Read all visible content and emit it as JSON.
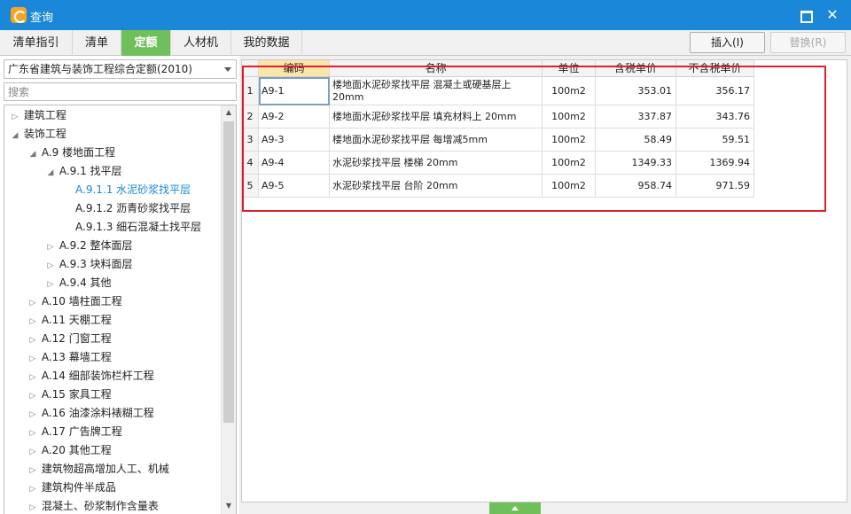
{
  "window": {
    "title": "查询",
    "maximize_icon": "maximize-icon",
    "close_symbol": "✕"
  },
  "tabs": [
    {
      "label": "清单指引",
      "active": false
    },
    {
      "label": "清单",
      "active": false
    },
    {
      "label": "定额",
      "active": true
    },
    {
      "label": "人材机",
      "active": false
    },
    {
      "label": "我的数据",
      "active": false
    }
  ],
  "toolbar": {
    "insert_label": "插入(I)",
    "replace_label": "替换(R)"
  },
  "left": {
    "quota_select": "广东省建筑与装饰工程综合定额(2010)",
    "search_placeholder": "搜索",
    "tree": [
      {
        "label": "建筑工程",
        "level": 0,
        "arrow": "▷"
      },
      {
        "label": "装饰工程",
        "level": 0,
        "arrow": "◢"
      },
      {
        "label": "A.9 楼地面工程",
        "level": 1,
        "arrow": "◢"
      },
      {
        "label": "A.9.1 找平层",
        "level": 2,
        "arrow": "◢"
      },
      {
        "label": "A.9.1.1 水泥砂浆找平层",
        "level": 3,
        "arrow": "",
        "selected": true
      },
      {
        "label": "A.9.1.2 沥青砂浆找平层",
        "level": 3,
        "arrow": ""
      },
      {
        "label": "A.9.1.3 细石混凝土找平层",
        "level": 3,
        "arrow": ""
      },
      {
        "label": "A.9.2 整体面层",
        "level": 2,
        "arrow": "▷"
      },
      {
        "label": "A.9.3 块料面层",
        "level": 2,
        "arrow": "▷"
      },
      {
        "label": "A.9.4 其他",
        "level": 2,
        "arrow": "▷"
      },
      {
        "label": "A.10 墙柱面工程",
        "level": 1,
        "arrow": "▷"
      },
      {
        "label": "A.11 天棚工程",
        "level": 1,
        "arrow": "▷"
      },
      {
        "label": "A.12 门窗工程",
        "level": 1,
        "arrow": "▷"
      },
      {
        "label": "A.13 幕墙工程",
        "level": 1,
        "arrow": "▷"
      },
      {
        "label": "A.14 细部装饰栏杆工程",
        "level": 1,
        "arrow": "▷"
      },
      {
        "label": "A.15 家具工程",
        "level": 1,
        "arrow": "▷"
      },
      {
        "label": "A.16 油漆涂料裱糊工程",
        "level": 1,
        "arrow": "▷"
      },
      {
        "label": "A.17 广告牌工程",
        "level": 1,
        "arrow": "▷"
      },
      {
        "label": "A.20 其他工程",
        "level": 1,
        "arrow": "▷"
      },
      {
        "label": "建筑物超高增加人工、机械",
        "level": 1,
        "arrow": "▷"
      },
      {
        "label": "建筑构件半成品",
        "level": 1,
        "arrow": "▷"
      },
      {
        "label": "混凝土、砂浆制作含量表",
        "level": 1,
        "arrow": "▷"
      }
    ]
  },
  "table": {
    "headers": [
      "编码",
      "名称",
      "单位",
      "含税单价",
      "不含税单价"
    ],
    "rows": [
      {
        "n": "1",
        "code": "A9-1",
        "name": "楼地面水泥砂浆找平层 混凝土或硬基层上 20mm",
        "unit": "100m2",
        "tax_price": "353.01",
        "notax_price": "356.17"
      },
      {
        "n": "2",
        "code": "A9-2",
        "name": "楼地面水泥砂浆找平层 填充材料上 20mm",
        "unit": "100m2",
        "tax_price": "337.87",
        "notax_price": "343.76"
      },
      {
        "n": "3",
        "code": "A9-3",
        "name": "楼地面水泥砂浆找平层 每增减5mm",
        "unit": "100m2",
        "tax_price": "58.49",
        "notax_price": "59.51"
      },
      {
        "n": "4",
        "code": "A9-4",
        "name": "水泥砂浆找平层 楼梯 20mm",
        "unit": "100m2",
        "tax_price": "1349.33",
        "notax_price": "1369.94"
      },
      {
        "n": "5",
        "code": "A9-5",
        "name": "水泥砂浆找平层 台阶 20mm",
        "unit": "100m2",
        "tax_price": "958.74",
        "notax_price": "971.59"
      }
    ]
  },
  "colors": {
    "titlebar": "#1a87d9",
    "tab_active": "#6fbf5b",
    "selection": "#1a87d9",
    "highlight_box": "#e01e2b",
    "header_highlight": "#fbe6a9"
  }
}
